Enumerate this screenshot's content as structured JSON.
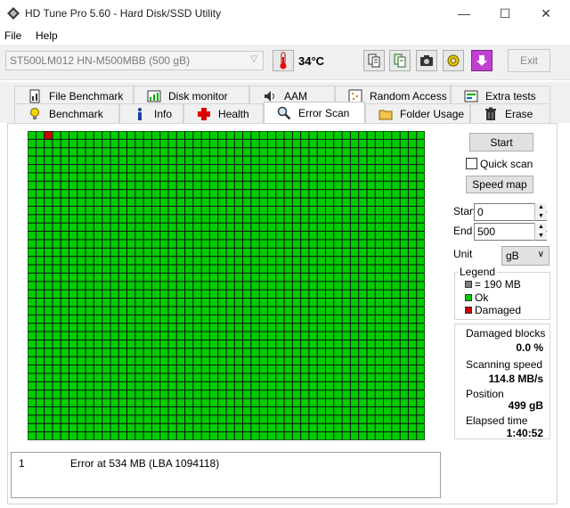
{
  "window": {
    "title": "HD Tune Pro 5.60 - Hard Disk/SSD Utility",
    "minimize": "—",
    "maximize": "☐",
    "close": "✕"
  },
  "menu": {
    "file": "File",
    "help": "Help"
  },
  "toolbar": {
    "drive": "ST500LM012 HN-M500MBB (500 gB)",
    "temperature": "34°C",
    "exit_label": "Exit"
  },
  "tabs_row1": [
    "File Benchmark",
    "Disk monitor",
    "AAM",
    "Random Access",
    "Extra tests"
  ],
  "tabs_row2": [
    "Benchmark",
    "Info",
    "Health",
    "Error Scan",
    "Folder Usage",
    "Erase"
  ],
  "active_tab": "Error Scan",
  "controls": {
    "start_label": "Start",
    "quick_scan_label": "Quick scan",
    "quick_scan_checked": false,
    "speed_map_label": "Speed map",
    "start_field_label": "Start",
    "start_value": "0",
    "end_field_label": "End",
    "end_value": "500",
    "unit_label": "Unit",
    "unit_value": "gB"
  },
  "legend": {
    "title": "Legend",
    "block_size": "= 190 MB",
    "ok_label": "Ok",
    "damaged_label": "Damaged",
    "colors": {
      "block": "#808080",
      "ok": "#00cc00",
      "damaged": "#cc0000"
    }
  },
  "stats": {
    "damaged_label": "Damaged blocks",
    "damaged_value": "0.0 %",
    "speed_label": "Scanning speed",
    "speed_value": "114.8 MB/s",
    "position_label": "Position",
    "position_value": "499 gB",
    "elapsed_label": "Elapsed time",
    "elapsed_value": "1:40:52"
  },
  "grid": {
    "columns": 48,
    "rows": 37,
    "ok_color": "#00cc00",
    "damaged_color": "#cc0000",
    "damaged_cells": [
      [
        0,
        2
      ]
    ]
  },
  "log": [
    {
      "index": "1",
      "message": "Error at 534 MB (LBA 1094118)"
    }
  ]
}
